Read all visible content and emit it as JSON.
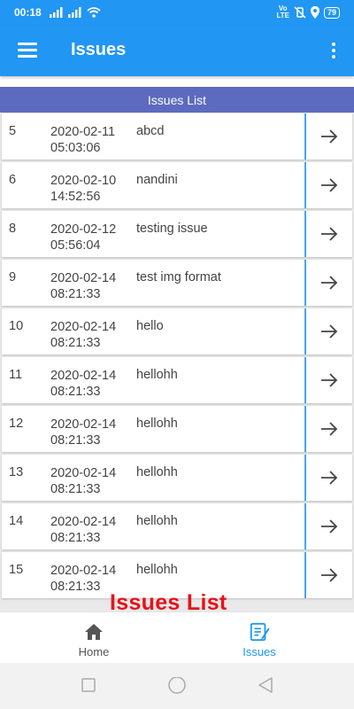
{
  "status_bar": {
    "time": "00:18",
    "volte_line1": "Vo",
    "volte_line2": "LTE",
    "battery": "79"
  },
  "app_bar": {
    "title": "Issues"
  },
  "section": {
    "title": "Issues List"
  },
  "issues": [
    {
      "id": "5",
      "date": "2020-02-11",
      "time": "05:03:06",
      "title": "abcd"
    },
    {
      "id": "6",
      "date": "2020-02-10",
      "time": "14:52:56",
      "title": "nandini"
    },
    {
      "id": "8",
      "date": "2020-02-12",
      "time": "05:56:04",
      "title": "testing issue"
    },
    {
      "id": "9",
      "date": "2020-02-14",
      "time": "08:21:33",
      "title": "test img format"
    },
    {
      "id": "10",
      "date": "2020-02-14",
      "time": "08:21:33",
      "title": "hello"
    },
    {
      "id": "11",
      "date": "2020-02-14",
      "time": "08:21:33",
      "title": "hellohh"
    },
    {
      "id": "12",
      "date": "2020-02-14",
      "time": "08:21:33",
      "title": "hellohh"
    },
    {
      "id": "13",
      "date": "2020-02-14",
      "time": "08:21:33",
      "title": "hellohh"
    },
    {
      "id": "14",
      "date": "2020-02-14",
      "time": "08:21:33",
      "title": "hellohh"
    },
    {
      "id": "15",
      "date": "2020-02-14",
      "time": "08:21:33",
      "title": "hellohh"
    }
  ],
  "overlay_caption": "Issues List",
  "bottom_nav": {
    "home_label": "Home",
    "issues_label": "Issues",
    "active": "issues"
  },
  "colors": {
    "primary": "#2196f3",
    "section_header": "#5c6bc0",
    "caption": "#e8121b",
    "divider": "#42a5f5"
  }
}
